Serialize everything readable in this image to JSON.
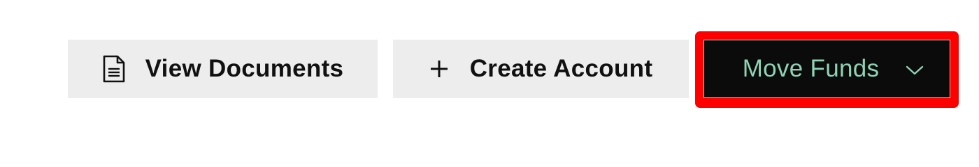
{
  "toolbar": {
    "view_documents": {
      "label": "View Documents",
      "icon": "document-icon"
    },
    "create_account": {
      "label": "Create Account",
      "icon": "plus-icon"
    },
    "move_funds": {
      "label": "Move Funds",
      "icon": "chevron-down-icon"
    }
  },
  "colors": {
    "light_button_bg": "#ededed",
    "dark_button_bg": "#0b0b0b",
    "dark_button_text": "#8fd3b4",
    "highlight_border": "#ff0000"
  }
}
